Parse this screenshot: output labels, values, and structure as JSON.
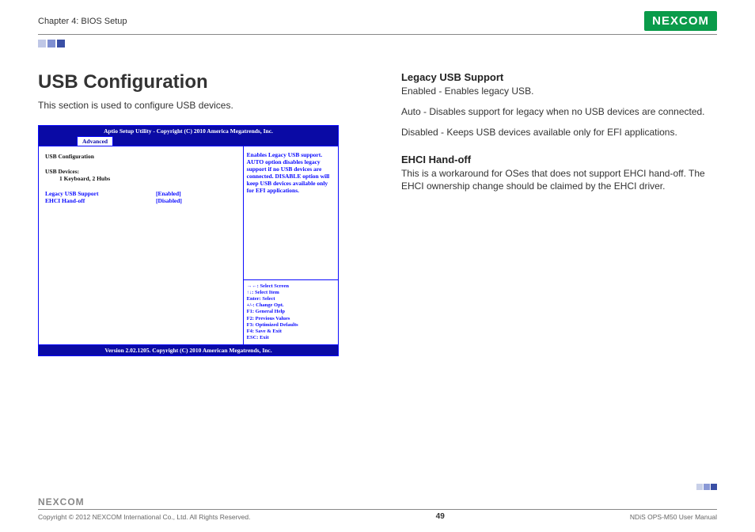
{
  "header": {
    "chapter": "Chapter 4: BIOS Setup",
    "logo_text": "NEXCOM"
  },
  "main": {
    "heading": "USB Configuration",
    "intro": "This section is used to configure USB devices."
  },
  "bios": {
    "titlebar": "Aptio Setup Utility - Copyright (C) 2010 America Megatrends, Inc.",
    "tab": "Advanced",
    "section_title": "USB Configuration",
    "devices_label": "USB Devices:",
    "devices_value": "1 Keyboard, 2 Hubs",
    "options": [
      {
        "label": "Legacy USB Support",
        "value": "[Enabled]"
      },
      {
        "label": "EHCI Hand-off",
        "value": "[Disabled]"
      }
    ],
    "help_text": "Enables Legacy USB support. AUTO option disables legacy support if no USB devices are connected. DISABLE option will keep USB devices available only for EFI applications.",
    "keys": {
      "k1": "→←: Select Screen",
      "k2": "↑↓: Select Item",
      "k3": "Enter: Select",
      "k4": "+/-: Change Opt.",
      "k5": "F1: General Help",
      "k6": "F2: Previous Values",
      "k7": "F3: Optimized Defaults",
      "k8": "F4: Save & Exit",
      "k9": "ESC: Exit"
    },
    "footer": "Version 2.02.1205. Copyright (C) 2010 American Megatrends, Inc."
  },
  "right": {
    "s1_head": "Legacy USB Support",
    "s1_p1": "Enabled - Enables legacy USB.",
    "s1_p2": "Auto - Disables support for legacy when no USB devices are connected.",
    "s1_p3": "Disabled - Keeps USB devices available only for EFI applications.",
    "s2_head": "EHCI Hand-off",
    "s2_p1": "This is a workaround for OSes that does not support EHCI hand-off. The EHCI ownership change should be claimed by the EHCI driver."
  },
  "footer": {
    "logo_text": "NEXCOM",
    "copyright": "Copyright © 2012 NEXCOM International Co., Ltd. All Rights Reserved.",
    "page": "49",
    "manual": "NDiS OPS-M50 User Manual"
  }
}
